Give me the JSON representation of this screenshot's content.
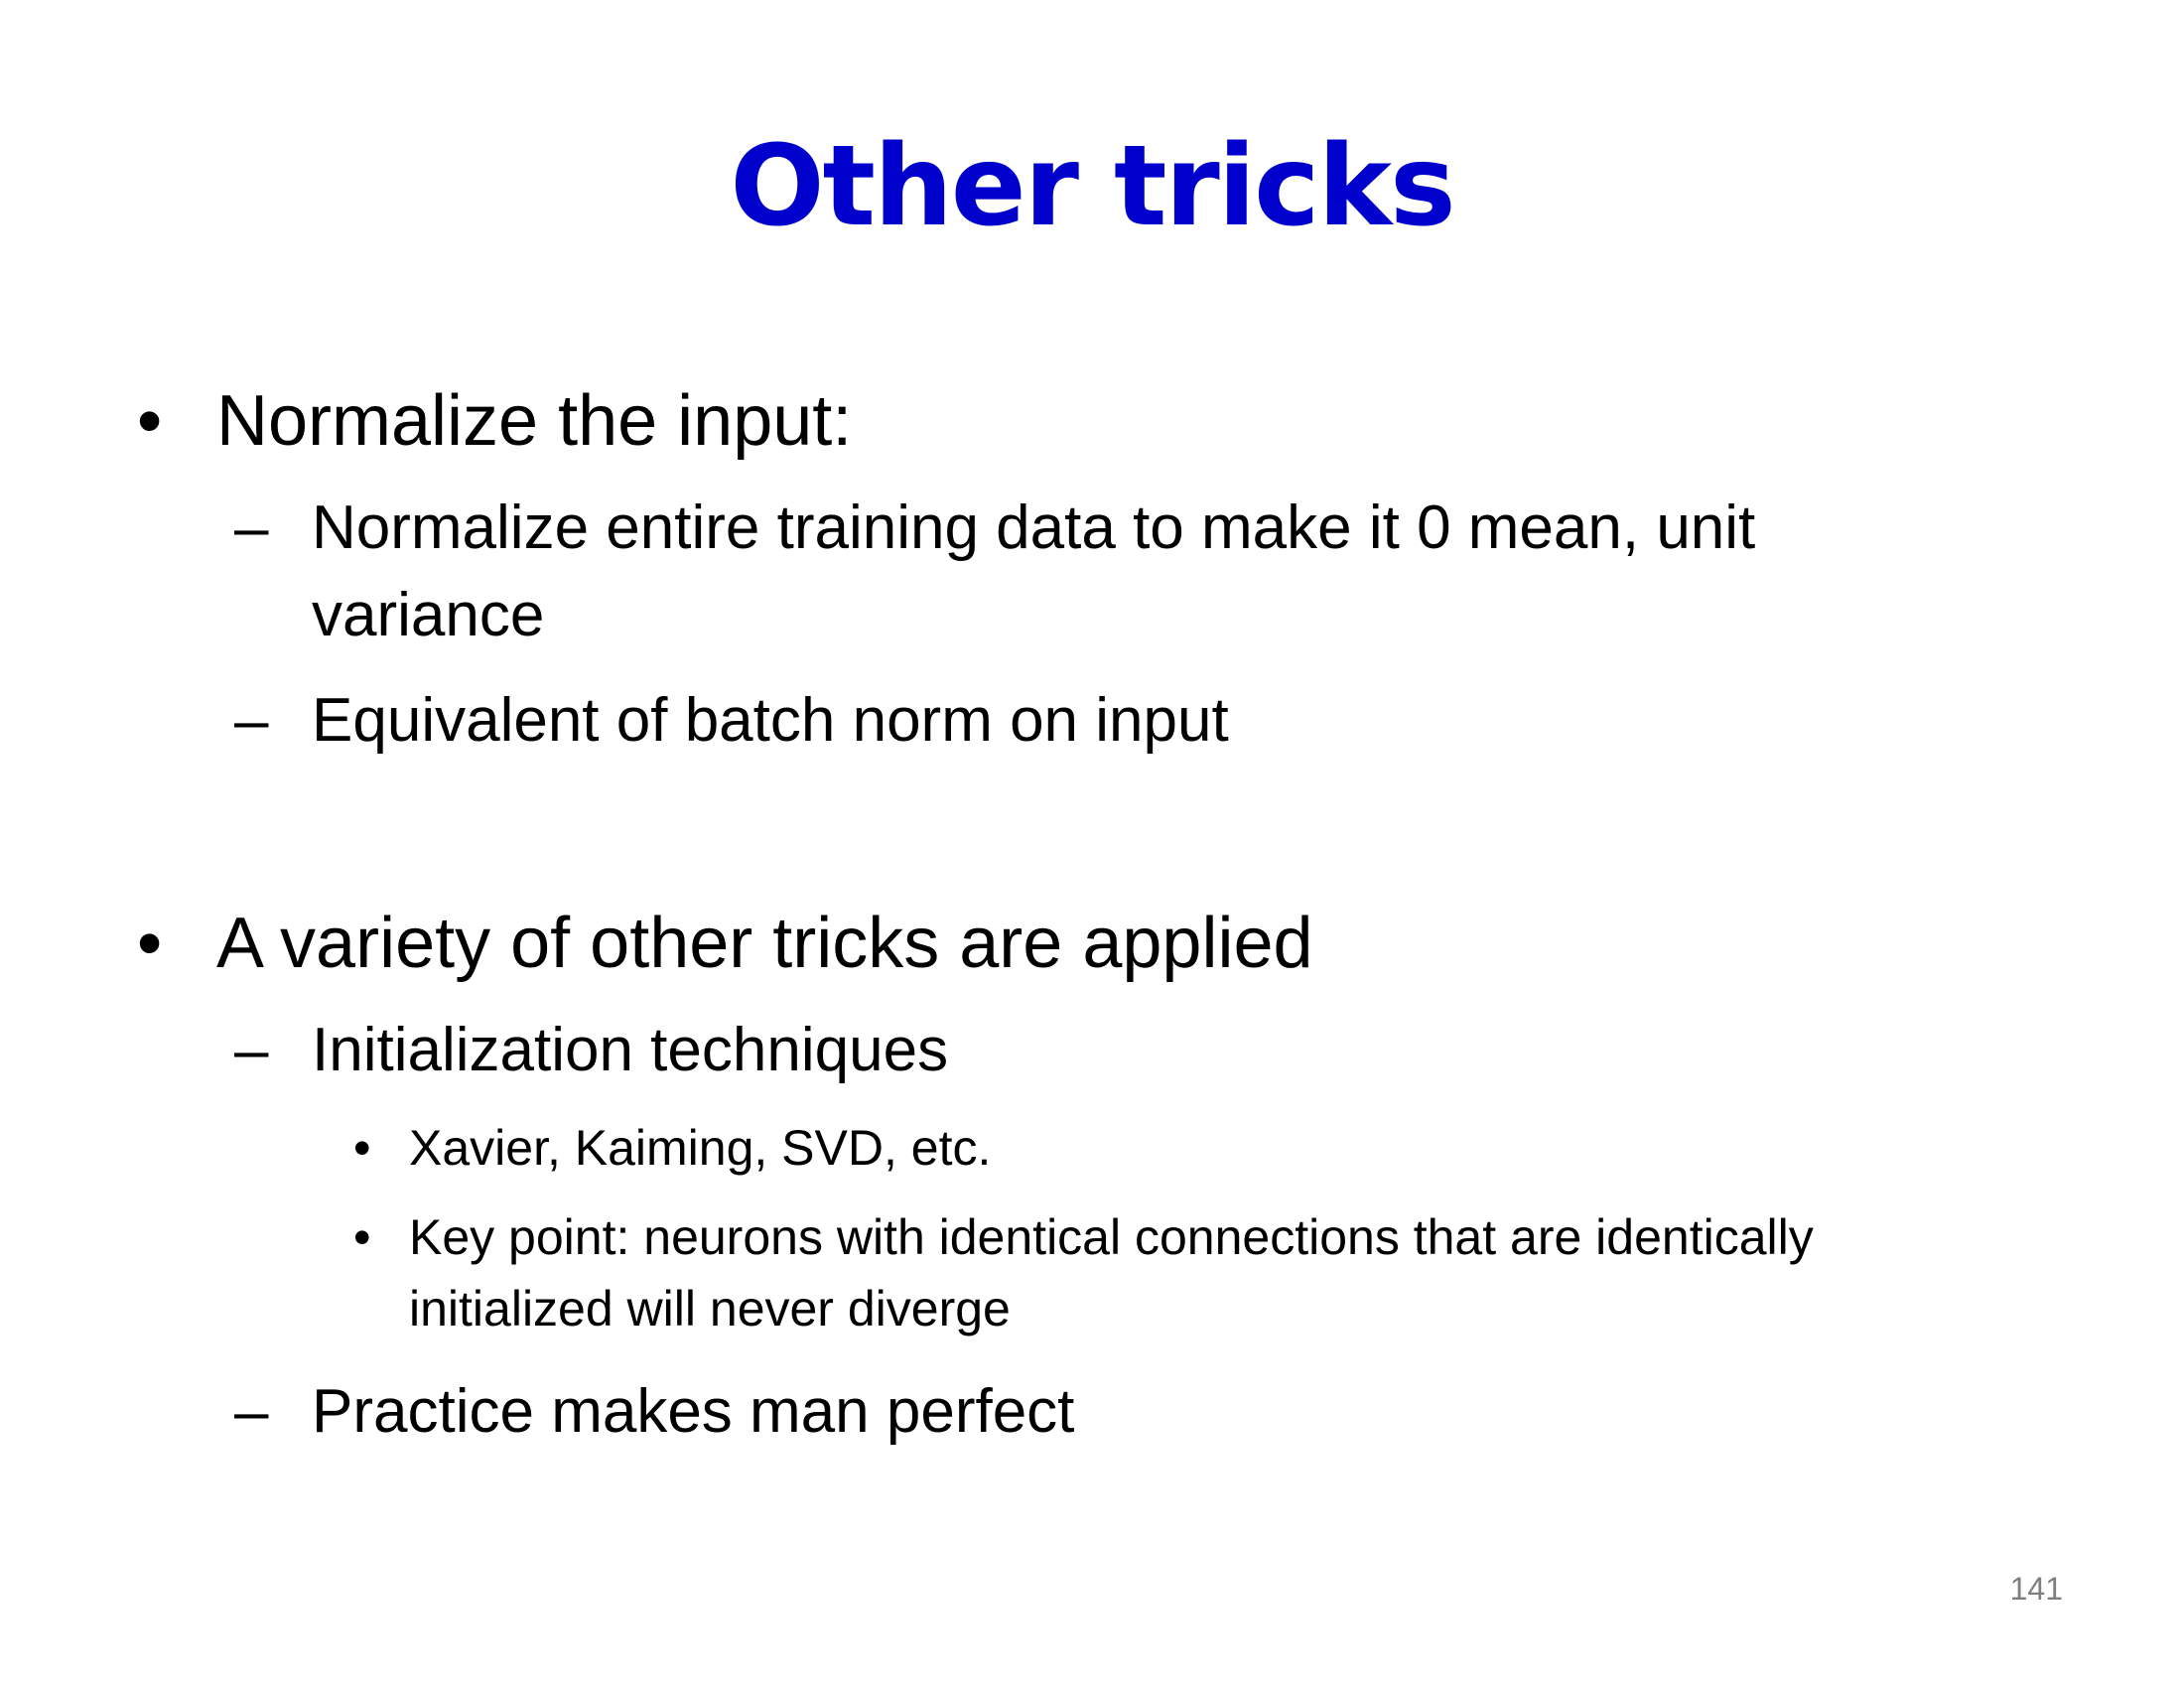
{
  "colors": {
    "title": "#0000CC",
    "body_text": "#000000",
    "page_number": "#7F7F7F",
    "background": "#FFFFFF"
  },
  "slide": {
    "title": "Other tricks",
    "bullet_symbol": "•",
    "dash_symbol": "–",
    "sections": [
      {
        "text": "Normalize the input:",
        "items": [
          {
            "line1": "Normalize entire training data to make it 0 mean, unit",
            "line2": "variance"
          },
          {
            "text": "Equivalent of batch norm on input"
          }
        ]
      },
      {
        "text": "A variety of other tricks are applied",
        "items": [
          {
            "text": "Initialization techniques",
            "subitems": [
              {
                "text": "Xavier, Kaiming, SVD, etc."
              },
              {
                "line1": "Key point:  neurons with identical connections that are identically",
                "line2": "initialized will never diverge"
              }
            ]
          },
          {
            "text": "Practice makes man perfect"
          }
        ]
      }
    ],
    "page_number": "141"
  }
}
